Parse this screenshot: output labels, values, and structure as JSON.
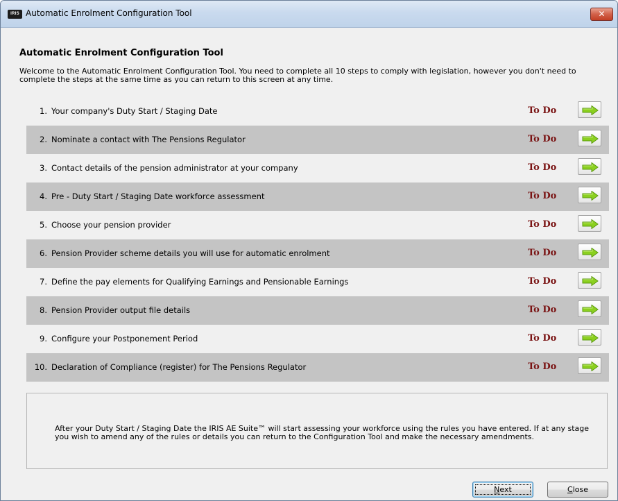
{
  "window": {
    "title": "Automatic Enrolment Configuration Tool",
    "icon_text": "IRIS",
    "close_glyph": "✕"
  },
  "main": {
    "heading": "Automatic Enrolment Configuration Tool",
    "intro": "Welcome to the Automatic Enrolment Configuration Tool.  You need to complete all 10 steps to comply with legislation, however you don't need to complete the steps at the same time as you can return to this screen at any time.",
    "steps": [
      {
        "num": "1.",
        "label": "Your company's Duty Start / Staging Date",
        "status": "To Do"
      },
      {
        "num": "2.",
        "label": "Nominate a contact with The Pensions Regulator",
        "status": "To Do"
      },
      {
        "num": "3.",
        "label": "Contact details of the pension administrator at your company",
        "status": "To Do"
      },
      {
        "num": "4.",
        "label": "Pre - Duty Start / Staging Date workforce assessment",
        "status": "To Do"
      },
      {
        "num": "5.",
        "label": "Choose your pension provider",
        "status": "To Do"
      },
      {
        "num": "6.",
        "label": "Pension Provider scheme details you will use for automatic enrolment",
        "status": "To Do"
      },
      {
        "num": "7.",
        "label": "Define the pay elements for Qualifying Earnings and Pensionable Earnings",
        "status": "To Do"
      },
      {
        "num": "8.",
        "label": "Pension Provider output file details",
        "status": "To Do"
      },
      {
        "num": "9.",
        "label": "Configure your Postponement Period",
        "status": "To Do"
      },
      {
        "num": "10.",
        "label": "Declaration of Compliance (register) for The Pensions Regulator",
        "status": "To Do"
      }
    ],
    "info": "After your Duty Start / Staging Date the IRIS AE Suite™ will start assessing your workforce using the rules you have entered.  If at any stage you wish to amend any of the rules or details you can return to the Configuration Tool and make the necessary amendments."
  },
  "buttons": {
    "next_first": "N",
    "next_rest": "ext",
    "close_first": "C",
    "close_rest": "lose"
  },
  "colors": {
    "status_todo": "#7a1414",
    "arrow_green": "#8bd01f",
    "row_shade": "#c4c4c4"
  },
  "icons": {
    "step_button": "green-right-arrow-icon"
  }
}
